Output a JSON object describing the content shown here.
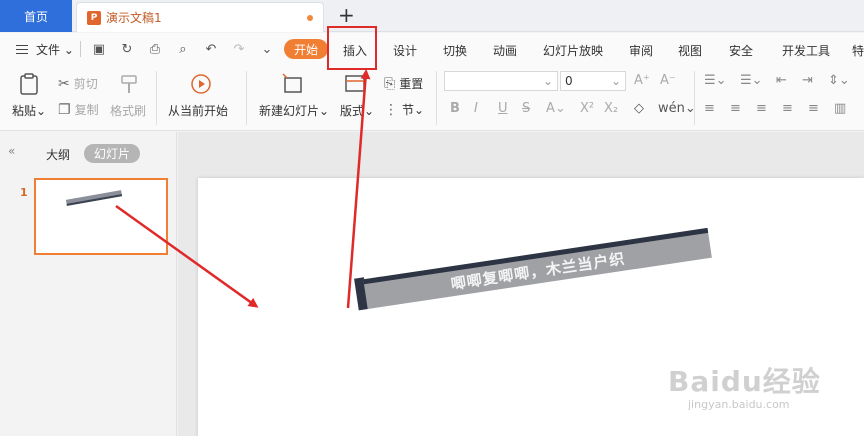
{
  "titlebar": {
    "home_tab": "首页",
    "doc_tab": "演示文稿1",
    "new_tab": "+"
  },
  "menubar": {
    "file": "文件",
    "tabs": [
      "开始",
      "插入",
      "设计",
      "切换",
      "动画",
      "幻灯片放映",
      "审阅",
      "视图",
      "安全",
      "开发工具",
      "特"
    ]
  },
  "ribbon": {
    "paste": "粘贴",
    "cut": "剪切",
    "copy": "复制",
    "format_painter": "格式刷",
    "from_current": "从当前开始",
    "new_slide": "新建幻灯片",
    "layout": "版式",
    "reset": "重置",
    "section": "节",
    "font_size": "0"
  },
  "leftpanel": {
    "outline_tab": "大纲",
    "slides_tab": "幻灯片",
    "slide_number": "1"
  },
  "slide": {
    "bar_text": "唧唧复唧唧，木兰当户织"
  },
  "watermark": {
    "brand": "Baidu经验",
    "url": "jingyan.baidu.com"
  },
  "colors": {
    "accent": "#f07f34",
    "home_tab": "#2f6fdc",
    "annotation": "#e02a2a"
  }
}
